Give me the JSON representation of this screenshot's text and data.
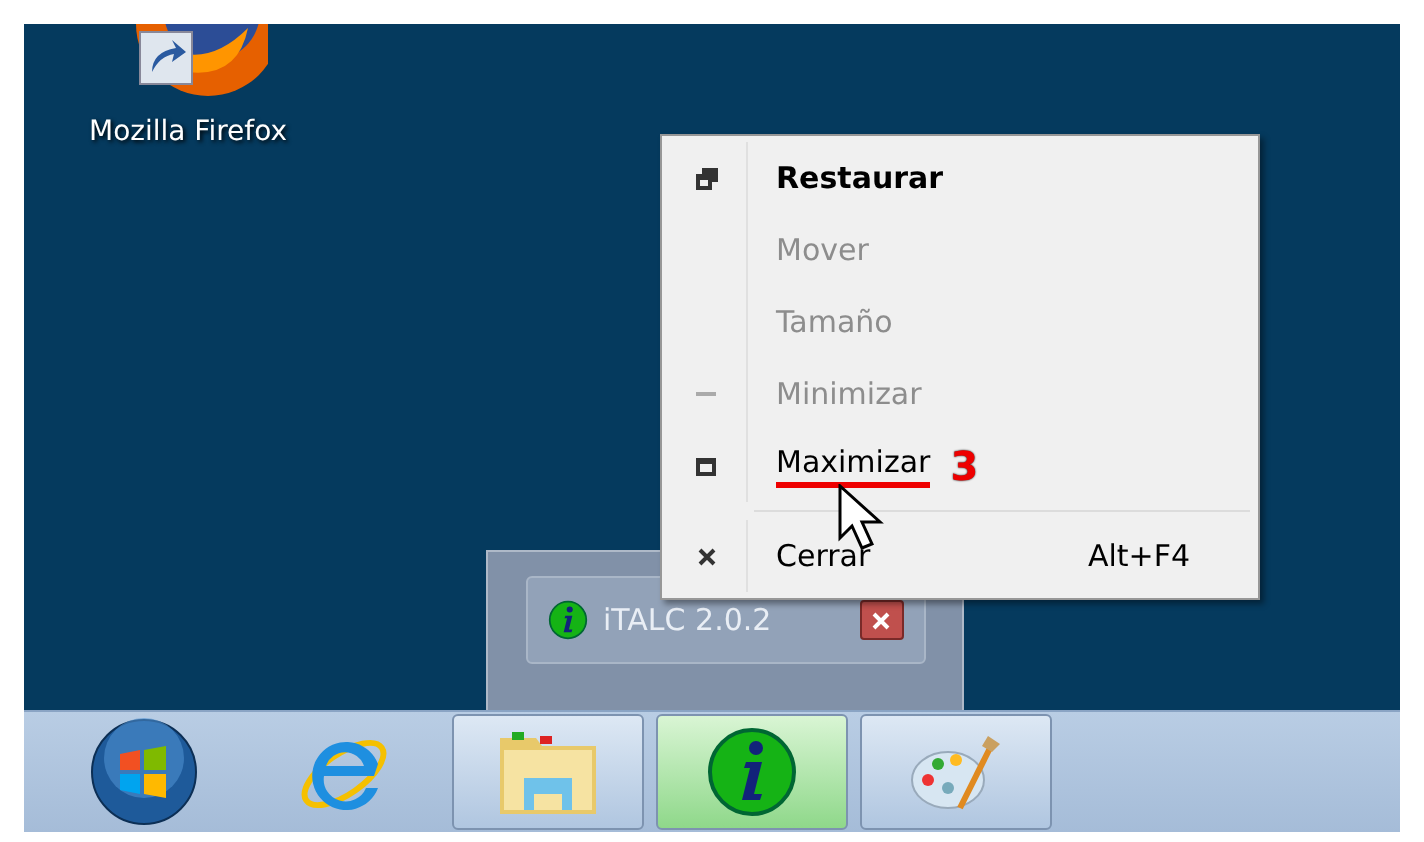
{
  "desktop_icons": [
    {
      "label": "Mozilla Firefox"
    }
  ],
  "context_menu": {
    "items": [
      {
        "kind": "item",
        "label": "Restaurar",
        "bold": true,
        "disabled": false
      },
      {
        "kind": "item",
        "label": "Mover",
        "bold": false,
        "disabled": true
      },
      {
        "kind": "item",
        "label": "Tamaño",
        "bold": false,
        "disabled": true
      },
      {
        "kind": "item",
        "label": "Minimizar",
        "bold": false,
        "disabled": true
      },
      {
        "kind": "item",
        "label": "Maximizar",
        "bold": false,
        "disabled": false,
        "annotation": "3"
      },
      {
        "kind": "separator"
      },
      {
        "kind": "item",
        "label": "Cerrar",
        "bold": false,
        "disabled": false,
        "shortcut": "Alt+F4"
      }
    ]
  },
  "thumbnail": {
    "title": "iTALC 2.0.2"
  },
  "taskbar": [
    {
      "kind": "start",
      "open": false,
      "selected": false
    },
    {
      "kind": "browser",
      "open": false,
      "selected": false
    },
    {
      "kind": "folder",
      "open": true,
      "selected": false
    },
    {
      "kind": "info",
      "open": true,
      "selected": true
    },
    {
      "kind": "paint",
      "open": true,
      "selected": false
    }
  ]
}
